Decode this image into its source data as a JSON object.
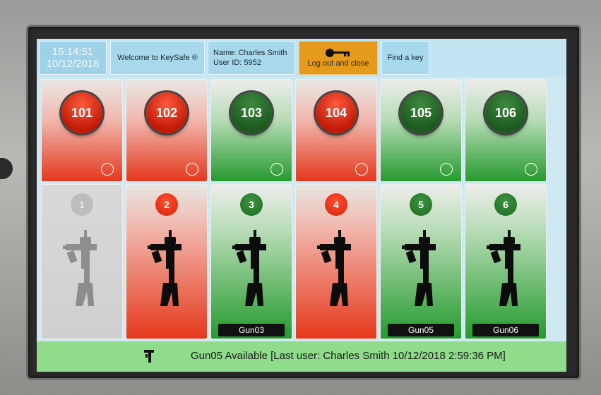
{
  "header": {
    "time": "15:14:51",
    "date": "10/12/2018",
    "welcome": "Welcome to KeySafe ®",
    "user_name": "Name:  Charles Smith",
    "user_id": "User ID:  5952",
    "logout_label": "Log out and close",
    "logout_icon": "key-icon",
    "find_key_label": "Find a key"
  },
  "key_slots": [
    {
      "number": "101",
      "status": "red"
    },
    {
      "number": "102",
      "status": "red"
    },
    {
      "number": "103",
      "status": "green"
    },
    {
      "number": "104",
      "status": "red"
    },
    {
      "number": "105",
      "status": "green"
    },
    {
      "number": "106",
      "status": "green"
    }
  ],
  "gun_lockers": [
    {
      "number": "1",
      "status": "grey",
      "label": ""
    },
    {
      "number": "2",
      "status": "red",
      "label": ""
    },
    {
      "number": "3",
      "status": "green",
      "label": "Gun03"
    },
    {
      "number": "4",
      "status": "red",
      "label": ""
    },
    {
      "number": "5",
      "status": "green",
      "label": "Gun05"
    },
    {
      "number": "6",
      "status": "green",
      "label": "Gun06"
    }
  ],
  "status_bar": {
    "message": "Gun05 Available [Last user: Charles Smith 10/12/2018 2:59:36 PM]",
    "icon": "gun-small-icon"
  },
  "colors": {
    "red": "#e4391c",
    "green": "#259a2e",
    "grey": "#cfcfcf",
    "logout_orange": "#e59a1c",
    "status_green": "#8fdc8a",
    "header_blue": "#a8d8ec"
  }
}
